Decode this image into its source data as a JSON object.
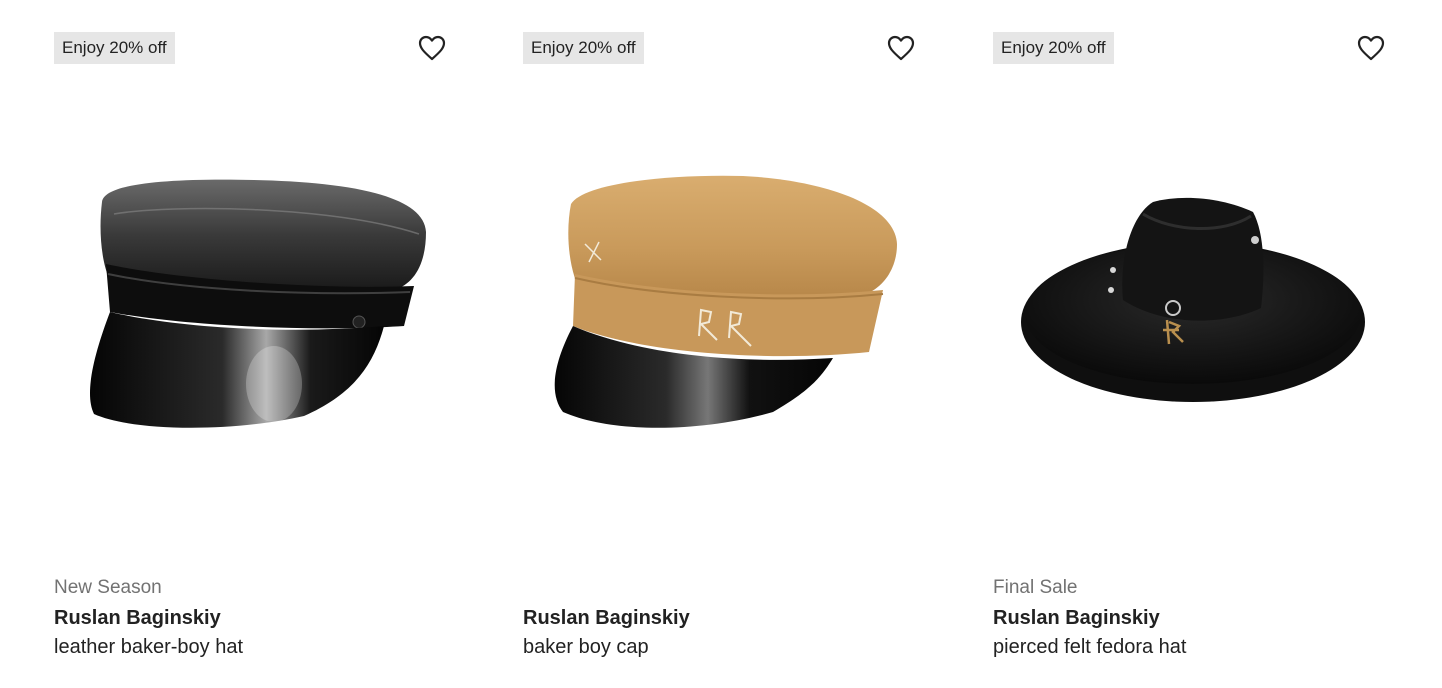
{
  "products": [
    {
      "badge": "Enjoy 20% off",
      "label": "New Season",
      "brand": "Ruslan Baginskiy",
      "name": "leather baker-boy hat",
      "wishlist_icon": "heart-outline-icon",
      "image": "black leather baker-boy hat with patent visor"
    },
    {
      "badge": "Enjoy 20% off",
      "label": "",
      "brand": "Ruslan Baginskiy",
      "name": "baker boy cap",
      "wishlist_icon": "heart-outline-icon",
      "image": "camel wool baker boy cap with black patent visor and RR stitching"
    },
    {
      "badge": "Enjoy 20% off",
      "label": "Final Sale",
      "brand": "Ruslan Baginskiy",
      "name": "pierced felt fedora hat",
      "wishlist_icon": "heart-outline-icon",
      "image": "black felt fedora hat with gold RR charm"
    }
  ],
  "colors": {
    "badge_bg": "#e6e6e6",
    "text": "#222222",
    "muted": "#727272"
  }
}
